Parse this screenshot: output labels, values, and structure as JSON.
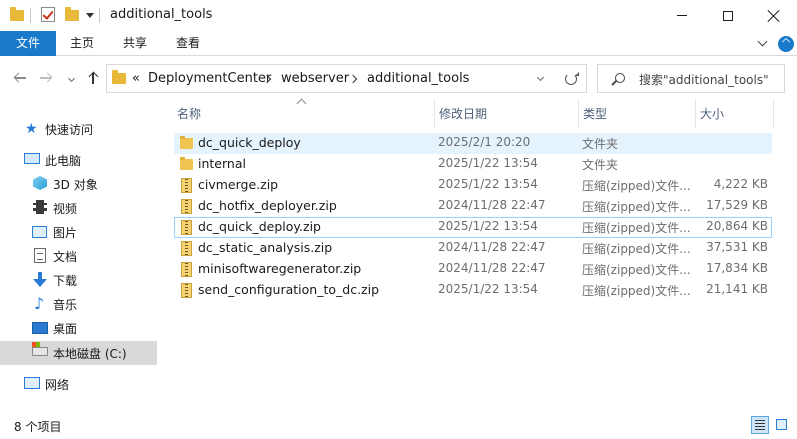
{
  "window": {
    "title": "additional_tools",
    "controls": {
      "minimize": "minimize-icon",
      "maximize": "maximize-icon",
      "close": "close-icon"
    }
  },
  "ribbon": {
    "tabs": [
      "文件",
      "主页",
      "共享",
      "查看"
    ]
  },
  "address": {
    "overflow": "«",
    "breadcrumbs": [
      "DeploymentCenter",
      "webserver",
      "additional_tools"
    ]
  },
  "search": {
    "placeholder": "搜索\"additional_tools\""
  },
  "sidebar": {
    "items": [
      {
        "label": "快速访问",
        "icon": "quick-access-star-icon"
      },
      {
        "label": "此电脑",
        "icon": "this-pc-icon"
      },
      {
        "label": "3D 对象",
        "icon": "3d-objects-icon"
      },
      {
        "label": "视频",
        "icon": "videos-icon"
      },
      {
        "label": "图片",
        "icon": "pictures-icon"
      },
      {
        "label": "文档",
        "icon": "documents-icon"
      },
      {
        "label": "下载",
        "icon": "downloads-icon"
      },
      {
        "label": "音乐",
        "icon": "music-icon"
      },
      {
        "label": "桌面",
        "icon": "desktop-icon"
      },
      {
        "label": "本地磁盘 (C:)",
        "icon": "local-disk-icon"
      },
      {
        "label": "网络",
        "icon": "network-icon"
      }
    ]
  },
  "columns": {
    "name": "名称",
    "date": "修改日期",
    "type": "类型",
    "size": "大小"
  },
  "files": [
    {
      "name": "dc_quick_deploy",
      "date": "2025/2/1 20:20",
      "type": "文件夹",
      "size": "",
      "kind": "folder"
    },
    {
      "name": "internal",
      "date": "2025/1/22 13:54",
      "type": "文件夹",
      "size": "",
      "kind": "folder"
    },
    {
      "name": "civmerge.zip",
      "date": "2025/1/22 13:54",
      "type": "压缩(zipped)文件...",
      "size": "4,222 KB",
      "kind": "zip"
    },
    {
      "name": "dc_hotfix_deployer.zip",
      "date": "2024/11/28 22:47",
      "type": "压缩(zipped)文件...",
      "size": "17,529 KB",
      "kind": "zip"
    },
    {
      "name": "dc_quick_deploy.zip",
      "date": "2025/1/22 13:54",
      "type": "压缩(zipped)文件...",
      "size": "20,864 KB",
      "kind": "zip"
    },
    {
      "name": "dc_static_analysis.zip",
      "date": "2024/11/28 22:47",
      "type": "压缩(zipped)文件...",
      "size": "37,531 KB",
      "kind": "zip"
    },
    {
      "name": "minisoftwaregenerator.zip",
      "date": "2024/11/28 22:47",
      "type": "压缩(zipped)文件...",
      "size": "17,834 KB",
      "kind": "zip"
    },
    {
      "name": "send_configuration_to_dc.zip",
      "date": "2025/1/22 13:54",
      "type": "压缩(zipped)文件...",
      "size": "21,141 KB",
      "kind": "zip"
    }
  ],
  "status": {
    "count": "8 个项目"
  },
  "colors": {
    "accent": "#1979ca",
    "hover": "#e5f3ff",
    "selected_border": "#99d1ff",
    "nav_selected": "#d9d9d9"
  }
}
